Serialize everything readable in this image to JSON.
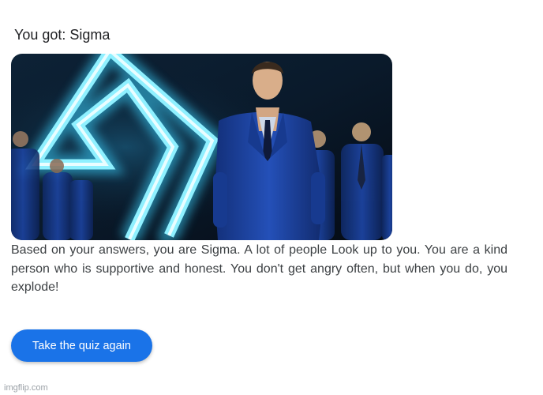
{
  "result": {
    "title": "You got: Sigma",
    "description": "Based on your answers, you are Sigma. A lot of people Look up to you. You are a kind person who is supportive and honest. You don't get angry often, but when you do, you explode!"
  },
  "actions": {
    "retake_label": "Take the quiz again"
  },
  "colors": {
    "button": "#1a73e8",
    "glow": "#5fe3ff",
    "suit": "#1d3f9a"
  },
  "watermark": "imgflip.com"
}
